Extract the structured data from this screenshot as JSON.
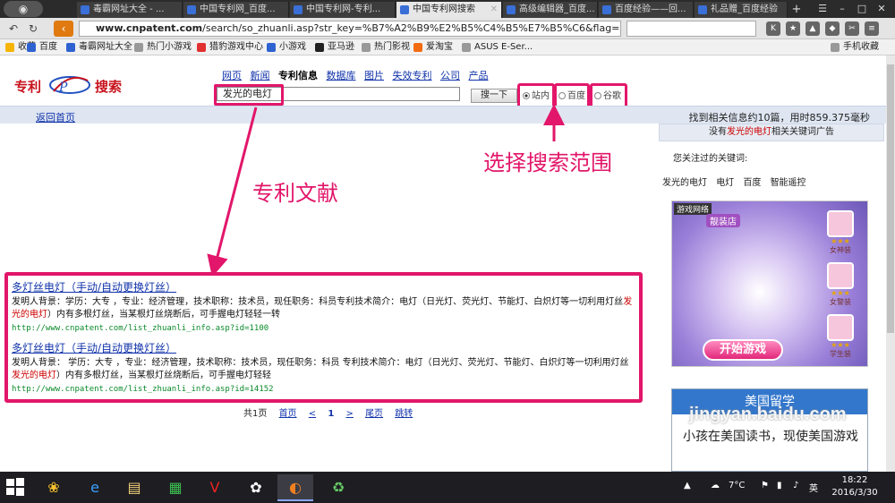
{
  "browser": {
    "tabs": [
      {
        "label": "毒霸网址大全 - ...",
        "left": 0
      },
      {
        "label": "中国专利网_百度..."
      },
      {
        "label": "中国专利网-专利..."
      },
      {
        "label": "中国专利网搜索"
      },
      {
        "label": "高级编辑器_百度..."
      },
      {
        "label": "百度经验——回..."
      },
      {
        "label": "礼品赠_百度经验"
      }
    ],
    "url_domain": "www.cnpatent.com",
    "url_rest": "/search/so_zhuanli.asp?str_key=%B7%A2%B9%E2%B5%C4%B5%E7%B5%C6&flag=zhu",
    "bookmarks": [
      "收藏",
      "百度",
      "毒霸网址大全",
      "热门小游戏",
      "猎豹游戏中心",
      "小游戏",
      "亚马逊",
      "热门影视",
      "爱淘宝",
      "ASUS E-Ser...",
      "手机收藏"
    ]
  },
  "site": {
    "logo_left": "专利",
    "logo_right": "搜索",
    "nav": [
      "网页",
      "新闻",
      "专利信息",
      "数据库",
      "图片",
      "失效专利",
      "公司",
      "产品"
    ],
    "query": "发光的电灯",
    "search_button": "搜一下",
    "scopes": [
      "站内",
      "百度",
      "谷歌"
    ],
    "back_home": "返回首页",
    "result_stats": "找到相关信息约10篇，用时859.375毫秒"
  },
  "annotations": {
    "scope": "选择搜索范围",
    "patent": "专利文献"
  },
  "results": [
    {
      "title": "多灯丝电灯（手动/自动更换灯丝）",
      "desc_a": "发明人背景：学历：大专 ，专业：经济管理，技术职称：技术员，现任职务：科员专利技术简介：电灯（日光灯、荧光灯、节能灯、白炽灯等一切利用灯丝",
      "desc_kw1": "发光的",
      "desc_kw2": "电灯",
      "desc_b": "）内有多根灯丝，当某根灯丝烧断后，可手握电灯轻轻一转",
      "url": "http://www.cnpatent.com/list_zhuanli_info.asp?id=1100"
    },
    {
      "title": "多灯丝电灯（手动/自动更换灯丝）",
      "desc_a": "发明人背景： 学历：大专 ，专业：经济管理，技术职称：技术员，现任职务：科员 专利技术简介：电灯（日光灯、荧光灯、节能灯、白炽灯等一切利用灯丝",
      "desc_kw1": "发光",
      "desc_kw2": "的电灯",
      "desc_b": "）内有多根灯丝，当某根灯丝烧断后，可手握电灯轻轻",
      "url": "http://www.cnpatent.com/list_zhuanli_info.asp?id=14152"
    }
  ],
  "pager": {
    "total": "共1页",
    "first": "首页",
    "prev": "<",
    "current": "1",
    "next": ">",
    "last": "尾页",
    "jump": "跳转"
  },
  "sidebar": {
    "no_ad_pre": "没有",
    "no_ad_kw": "发光的电灯",
    "no_ad_post": "相关关键词广告",
    "keywords_title": "您关注过的关键词:",
    "keywords": [
      "发光的电灯",
      "电灯",
      "百度",
      "智能遥控"
    ],
    "game_brand": "游戏网络",
    "game_tag": "靓装店",
    "game_items": [
      "女神装",
      "女警装",
      "学生装"
    ],
    "game_start": "开始游戏",
    "study_title": "美国留学",
    "study_text": "小孩在美国读书，现使美国游戏"
  },
  "watermark": "jingyan.baidu.com",
  "taskbar": {
    "temperature": "7°C",
    "ime": "英",
    "time": "18:22",
    "date": "2016/3/30"
  },
  "colors": {
    "annotation": "#e2166a",
    "link": "#1133aa",
    "keyword": "#cc0000",
    "url_green": "#0a8a2a"
  }
}
